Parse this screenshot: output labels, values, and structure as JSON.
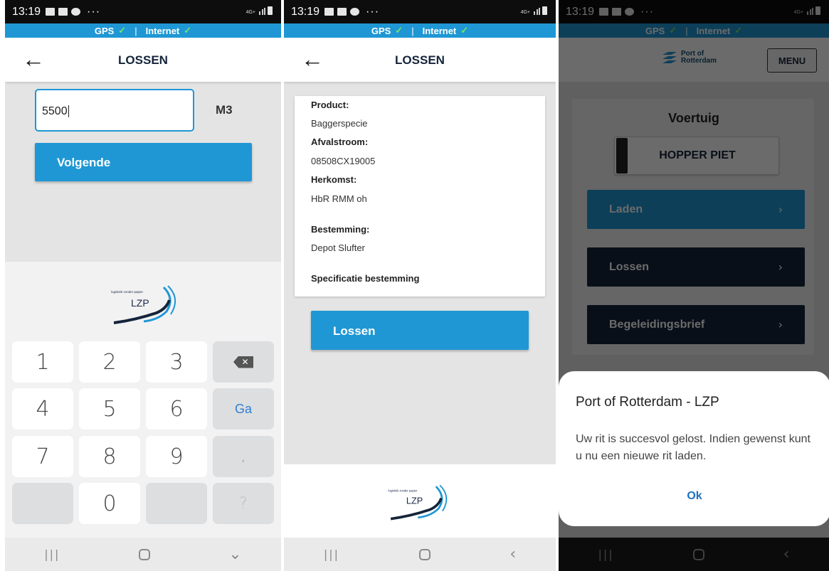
{
  "status": {
    "time": "13:19",
    "dots": "···",
    "network": "4G+"
  },
  "connection": {
    "gps": "GPS",
    "internet": "Internet",
    "separator": "|",
    "check": "✓"
  },
  "screen1": {
    "title": "LOSSEN",
    "quantity_value": "5500",
    "unit": "M3",
    "next_button": "Volgende",
    "keyboard": {
      "keys": [
        "1",
        "2",
        "3",
        "⌫",
        "4",
        "5",
        "6",
        "Ga",
        "7",
        "8",
        "9",
        ",",
        "",
        "0",
        "",
        "?"
      ]
    }
  },
  "screen2": {
    "title": "LOSSEN",
    "fields": [
      {
        "label": "Product:",
        "value": "Baggerspecie"
      },
      {
        "label": "Afvalstroom:",
        "value": "08508CX19005"
      },
      {
        "label": "Herkomst:",
        "value": "HbR RMM oh"
      },
      {
        "label": "Bestemming:",
        "value": "Depot Slufter"
      },
      {
        "label": "Specificatie bestemming",
        "value": ""
      }
    ],
    "unload_button": "Lossen"
  },
  "logo": {
    "tagline": "logistiek zonder papier",
    "name": "LZP"
  },
  "screen3": {
    "logo_line1": "Port of",
    "logo_line2": "Rotterdam",
    "menu_button": "MENU",
    "vehicle_title": "Voertuig",
    "vehicle_name": "HOPPER PIET",
    "rows": [
      "Laden",
      "Lossen",
      "Begeleidingsbrief"
    ],
    "chevron": "›",
    "dialog": {
      "title": "Port of Rotterdam - LZP",
      "message": "Uw rit is succesvol gelost. Indien gewenst kunt u nu een nieuwe rit laden.",
      "ok": "Ok"
    }
  },
  "colors": {
    "accent": "#1f97d4",
    "navy": "#14243a",
    "check": "#74e36c"
  }
}
